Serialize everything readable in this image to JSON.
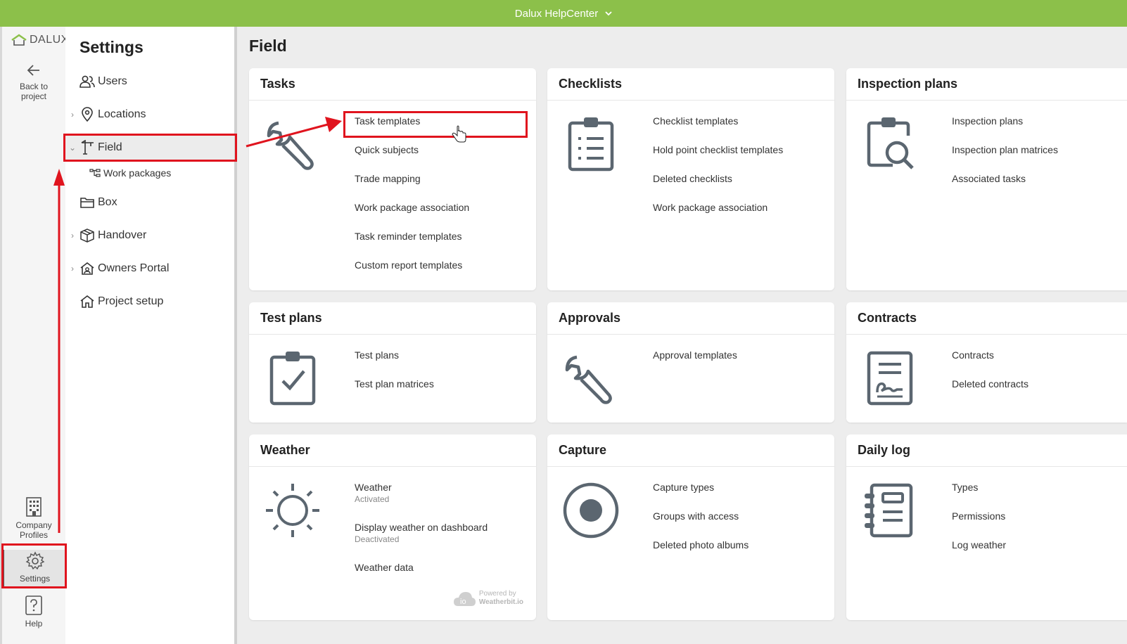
{
  "topbar": {
    "title": "Dalux HelpCenter"
  },
  "rail": {
    "logo": "DALUX",
    "back_label": "Back to project",
    "company_label": "Company Profiles",
    "settings_label": "Settings",
    "help_label": "Help"
  },
  "settings": {
    "title": "Settings",
    "items": [
      {
        "label": "Users"
      },
      {
        "label": "Locations"
      },
      {
        "label": "Field"
      },
      {
        "label": "Work packages"
      },
      {
        "label": "Box"
      },
      {
        "label": "Handover"
      },
      {
        "label": "Owners Portal"
      },
      {
        "label": "Project setup"
      }
    ]
  },
  "main": {
    "title": "Field",
    "cards": {
      "tasks": {
        "title": "Tasks",
        "links": [
          "Task templates",
          "Quick subjects",
          "Trade mapping",
          "Work package association",
          "Task reminder templates",
          "Custom report templates"
        ]
      },
      "checklists": {
        "title": "Checklists",
        "links": [
          "Checklist templates",
          "Hold point checklist templates",
          "Deleted checklists",
          "Work package association"
        ]
      },
      "inspection": {
        "title": "Inspection plans",
        "links": [
          "Inspection plans",
          "Inspection plan matrices",
          "Associated tasks"
        ]
      },
      "testplans": {
        "title": "Test plans",
        "links": [
          "Test plans",
          "Test plan matrices"
        ]
      },
      "approvals": {
        "title": "Approvals",
        "links": [
          "Approval templates"
        ]
      },
      "contracts": {
        "title": "Contracts",
        "links": [
          "Contracts",
          "Deleted contracts"
        ]
      },
      "weather": {
        "title": "Weather",
        "weather_label": "Weather",
        "weather_status": "Activated",
        "dashboard_label": "Display weather on dashboard",
        "dashboard_status": "Deactivated",
        "data_label": "Weather data",
        "powered_by": "Powered by",
        "provider": "Weatherbit.io",
        "logo_text": "io"
      },
      "capture": {
        "title": "Capture",
        "links": [
          "Capture types",
          "Groups with access",
          "Deleted photo albums"
        ]
      },
      "dailylog": {
        "title": "Daily log",
        "links": [
          "Types",
          "Permissions",
          "Log weather"
        ]
      }
    }
  },
  "colors": {
    "topbar": "#8cc04a",
    "highlight": "#e0141e",
    "icon": "#5b6670"
  }
}
